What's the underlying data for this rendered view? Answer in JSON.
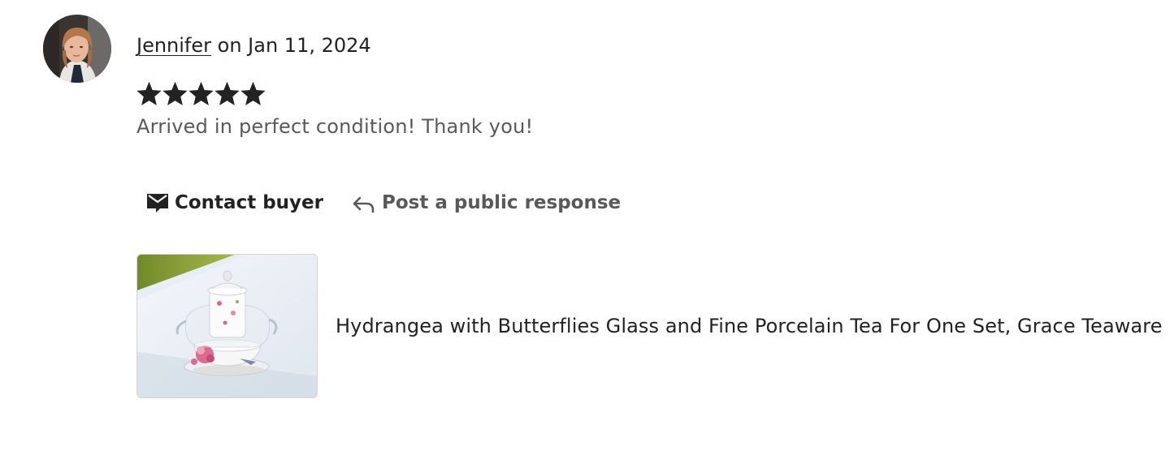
{
  "review": {
    "reviewer_name": "Jennifer",
    "date_text": " on Jan 11, 2024",
    "rating": 5,
    "rating_max": 5,
    "text": "Arrived in perfect condition! Thank you!"
  },
  "actions": {
    "contact_label": "Contact buyer",
    "contact_icon": "envelope-icon",
    "respond_label": "Post a public response",
    "respond_icon": "reply-arrow-icon"
  },
  "product": {
    "title": "Hydrangea with Butterflies Glass and Fine Porcelain Tea For One Set, Grace Teaware"
  },
  "colors": {
    "text_primary": "#222222",
    "text_secondary": "#595959",
    "star": "#222222"
  }
}
